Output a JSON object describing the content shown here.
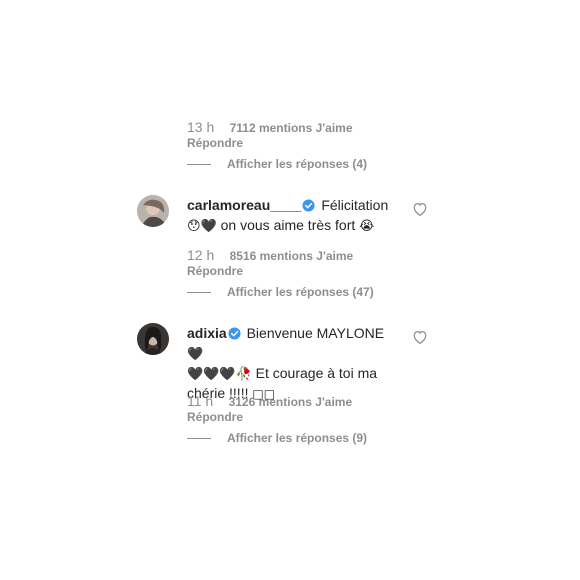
{
  "colors": {
    "secondary": "#8e8e8e",
    "text": "#262626",
    "verified": "#3897f0"
  },
  "comments": [
    {
      "time": "13 h",
      "likes": "7112 mentions J'aime",
      "reply": "Répondre",
      "view_replies": "Afficher les réponses (4)"
    },
    {
      "username": "carlamoreau____",
      "text_a": "Félicitation",
      "emoji_face": "😯",
      "emoji_heart": "🖤",
      "text_b": "on vous aime très fort",
      "emoji_end": "😭",
      "time": "12 h",
      "likes": "8516 mentions J'aime",
      "reply": "Répondre",
      "view_replies": "Afficher les réponses (47)"
    },
    {
      "username": "adixia",
      "text_a": "Bienvenue MAYLONE",
      "hearts": "🖤",
      "hearts_line2": "🖤🖤🖤",
      "rose": "🥀",
      "text_b": "Et courage à toi ma chérie !!!!!",
      "boxes": "□□",
      "time": "11 h",
      "likes": "3126 mentions J'aime",
      "reply": "Répondre",
      "view_replies": "Afficher les réponses (9)"
    }
  ]
}
